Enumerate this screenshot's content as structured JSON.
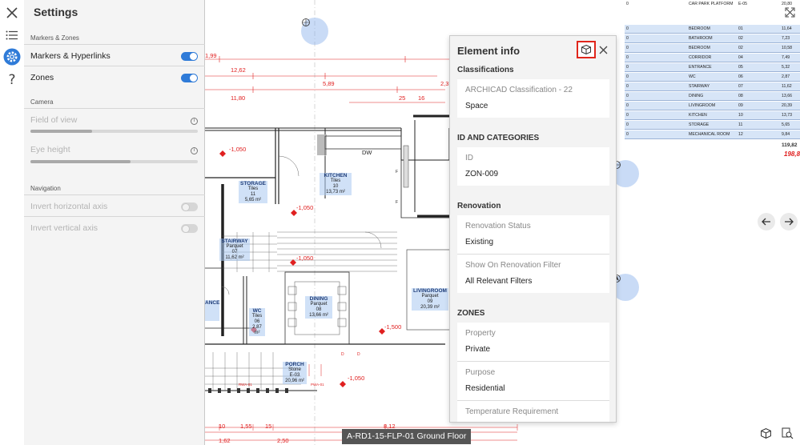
{
  "settings": {
    "title": "Settings",
    "markers_zones": {
      "heading": "Markers & Zones",
      "markers_label": "Markers & Hyperlinks",
      "markers_on": true,
      "zones_label": "Zones",
      "zones_on": true
    },
    "camera": {
      "heading": "Camera",
      "fov_label": "Field of view",
      "fov_level": 0.37,
      "eye_label": "Eye height",
      "eye_level": 0.6
    },
    "navigation": {
      "heading": "Navigation",
      "invert_h_label": "Invert horizontal axis",
      "invert_h_on": false,
      "invert_v_label": "Invert vertical axis",
      "invert_v_on": false
    }
  },
  "rail": {
    "icons": [
      "close-icon",
      "list-icon",
      "gear-icon",
      "help-icon"
    ]
  },
  "drawing": {
    "dims": [
      "1,99",
      "12,62",
      "5,89",
      "2,3",
      "11,80",
      "25",
      "16",
      "-1,050",
      "-1,050",
      "-1,050",
      "-1,500",
      "-1,050",
      "DW",
      "F",
      "F",
      "10",
      "1,55",
      "15",
      "8,12",
      "1,62",
      "2,50",
      "D",
      "D",
      "RWA-01",
      "PWA-01"
    ],
    "rooms": [
      {
        "name": "STORAGE",
        "finish": "Tiles",
        "no": "11",
        "area": "5,65 m²"
      },
      {
        "name": "KITCHEN",
        "finish": "Tiles",
        "no": "10",
        "area": "13,73 m²"
      },
      {
        "name": "STAIRWAY",
        "finish": "Parquet",
        "no": "07",
        "area": "11,62 m²"
      },
      {
        "name": "DINING",
        "finish": "Parquet",
        "no": "08",
        "area": "13,66 m²"
      },
      {
        "name": "LIVINGROOM",
        "finish": "Parquet",
        "no": "09",
        "area": "20,39 m²"
      },
      {
        "name": "WC",
        "finish": "Tiles",
        "no": "06",
        "area": "2,87 m²"
      },
      {
        "name": "ANCE",
        "finish": "",
        "no": "",
        "area": ""
      },
      {
        "name": "PORCH",
        "finish": "Stone",
        "no": "E-03",
        "area": "20,96 m²"
      }
    ]
  },
  "schedule": {
    "rows": [
      {
        "c1": "0",
        "c2": "CAR PARK PLATFORM",
        "c3": "E-05",
        "c4": "20,80"
      },
      {
        "c1": "0",
        "c2": "BEDROOM",
        "c3": "01",
        "c4": "11,64"
      },
      {
        "c1": "0",
        "c2": "BATHROOM",
        "c3": "02",
        "c4": "7,23"
      },
      {
        "c1": "0",
        "c2": "BEDROOM",
        "c3": "02",
        "c4": "10,58"
      },
      {
        "c1": "0",
        "c2": "CORRIDOR",
        "c3": "04",
        "c4": "7,49"
      },
      {
        "c1": "0",
        "c2": "ENTRANCE",
        "c3": "05",
        "c4": "5,32"
      },
      {
        "c1": "0",
        "c2": "WC",
        "c3": "06",
        "c4": "2,87"
      },
      {
        "c1": "0",
        "c2": "STAIRWAY",
        "c3": "07",
        "c4": "11,62"
      },
      {
        "c1": "0",
        "c2": "DINING",
        "c3": "08",
        "c4": "13,66"
      },
      {
        "c1": "0",
        "c2": "LIVINGROOM",
        "c3": "09",
        "c4": "20,39"
      },
      {
        "c1": "0",
        "c2": "KITCHEN",
        "c3": "10",
        "c4": "13,73"
      },
      {
        "c1": "0",
        "c2": "STORAGE",
        "c3": "11",
        "c4": "5,65"
      },
      {
        "c1": "0",
        "c2": "MECHANICAL ROOM",
        "c3": "12",
        "c4": "9,84"
      }
    ],
    "total": "119,82",
    "total_alt": "198,8"
  },
  "element_info": {
    "title": "Element info",
    "classifications": {
      "heading": "Classifications",
      "system": "ARCHICAD Classification - 22",
      "value": "Space"
    },
    "id_categories": {
      "heading": "ID AND CATEGORIES",
      "id_label": "ID",
      "id_value": "ZON-009"
    },
    "renovation": {
      "heading": "Renovation",
      "status_label": "Renovation Status",
      "status_value": "Existing",
      "filter_label": "Show On Renovation Filter",
      "filter_value": "All Relevant Filters"
    },
    "zones": {
      "heading": "ZONES",
      "property_label": "Property",
      "property_value": "Private",
      "purpose_label": "Purpose",
      "purpose_value": "Residential",
      "temp_label": "Temperature Requirement"
    }
  },
  "footer": {
    "floor_label": "A-RD1-15-FLP-01 Ground Floor"
  },
  "colors": {
    "accent": "#2f7bd8",
    "highlight_border": "#e0261b",
    "dimension_red": "#e02020"
  }
}
